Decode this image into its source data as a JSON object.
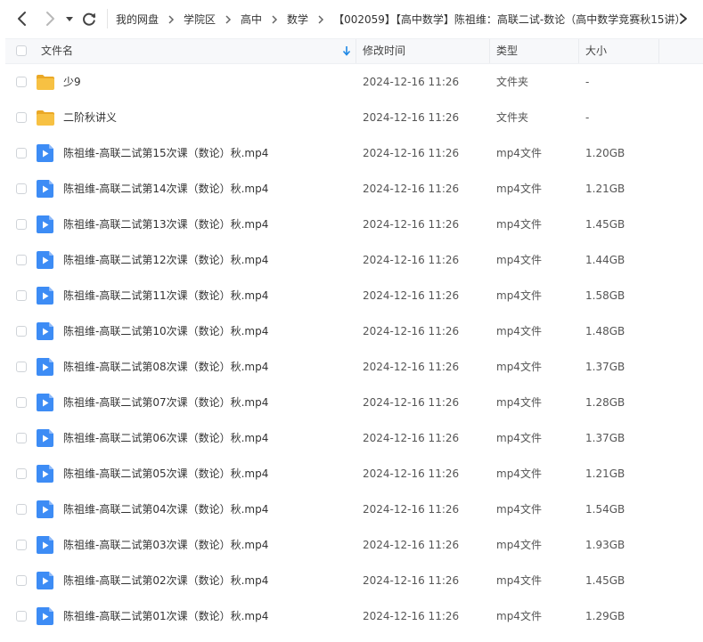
{
  "nav": {
    "back_icon": "chevron-left-icon",
    "forward_icon": "chevron-right-icon",
    "history_icon": "caret-down-icon",
    "refresh_icon": "refresh-icon"
  },
  "breadcrumb": [
    "我的网盘",
    "学院区",
    "高中",
    "数学",
    "【002059】【高中数学】陈祖维：高联二试-数论（高中数学竞赛秋15讲）"
  ],
  "table": {
    "columns": {
      "name": "文件名",
      "mtime": "修改时间",
      "type": "类型",
      "size": "大小"
    },
    "sort_indicator": "sort-down-arrow-icon",
    "rows": [
      {
        "kind": "folder",
        "name": "少9",
        "mtime": "2024-12-16 11:26",
        "type": "文件夹",
        "size": "-"
      },
      {
        "kind": "folder",
        "name": "二阶秋讲义",
        "mtime": "2024-12-16 11:26",
        "type": "文件夹",
        "size": "-"
      },
      {
        "kind": "video",
        "name": "陈祖维-高联二试第15次课（数论）秋.mp4",
        "mtime": "2024-12-16 11:26",
        "type": "mp4文件",
        "size": "1.20GB"
      },
      {
        "kind": "video",
        "name": "陈祖维-高联二试第14次课（数论）秋.mp4",
        "mtime": "2024-12-16 11:26",
        "type": "mp4文件",
        "size": "1.21GB"
      },
      {
        "kind": "video",
        "name": "陈祖维-高联二试第13次课（数论）秋.mp4",
        "mtime": "2024-12-16 11:26",
        "type": "mp4文件",
        "size": "1.45GB"
      },
      {
        "kind": "video",
        "name": "陈祖维-高联二试第12次课（数论）秋.mp4",
        "mtime": "2024-12-16 11:26",
        "type": "mp4文件",
        "size": "1.44GB"
      },
      {
        "kind": "video",
        "name": "陈祖维-高联二试第11次课（数论）秋.mp4",
        "mtime": "2024-12-16 11:26",
        "type": "mp4文件",
        "size": "1.58GB"
      },
      {
        "kind": "video",
        "name": "陈祖维-高联二试第10次课（数论）秋.mp4",
        "mtime": "2024-12-16 11:26",
        "type": "mp4文件",
        "size": "1.48GB"
      },
      {
        "kind": "video",
        "name": "陈祖维-高联二试第08次课（数论）秋.mp4",
        "mtime": "2024-12-16 11:26",
        "type": "mp4文件",
        "size": "1.37GB"
      },
      {
        "kind": "video",
        "name": "陈祖维-高联二试第07次课（数论）秋.mp4",
        "mtime": "2024-12-16 11:26",
        "type": "mp4文件",
        "size": "1.28GB"
      },
      {
        "kind": "video",
        "name": "陈祖维-高联二试第06次课（数论）秋.mp4",
        "mtime": "2024-12-16 11:26",
        "type": "mp4文件",
        "size": "1.37GB"
      },
      {
        "kind": "video",
        "name": "陈祖维-高联二试第05次课（数论）秋.mp4",
        "mtime": "2024-12-16 11:26",
        "type": "mp4文件",
        "size": "1.21GB"
      },
      {
        "kind": "video",
        "name": "陈祖维-高联二试第04次课（数论）秋.mp4",
        "mtime": "2024-12-16 11:26",
        "type": "mp4文件",
        "size": "1.54GB"
      },
      {
        "kind": "video",
        "name": "陈祖维-高联二试第03次课（数论）秋.mp4",
        "mtime": "2024-12-16 11:26",
        "type": "mp4文件",
        "size": "1.93GB"
      },
      {
        "kind": "video",
        "name": "陈祖维-高联二试第02次课（数论）秋.mp4",
        "mtime": "2024-12-16 11:26",
        "type": "mp4文件",
        "size": "1.45GB"
      },
      {
        "kind": "video",
        "name": "陈祖维-高联二试第01次课（数论）秋.mp4",
        "mtime": "2024-12-16 11:26",
        "type": "mp4文件",
        "size": "1.29GB"
      }
    ]
  },
  "colors": {
    "folder": "#f7c143",
    "folder_tab": "#eaa826",
    "video": "#3d8cf5",
    "accent": "#1e88e5"
  }
}
